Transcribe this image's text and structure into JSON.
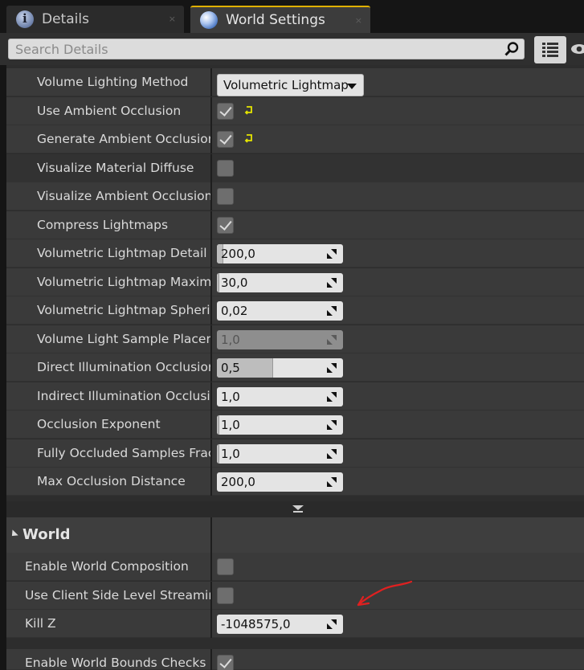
{
  "tabs": [
    {
      "label": "Details",
      "icon": "info-icon",
      "close": "×"
    },
    {
      "label": "World Settings",
      "icon": "globe-icon",
      "close": "×"
    }
  ],
  "search": {
    "placeholder": "Search Details"
  },
  "lighting_rows": [
    {
      "label": "Volume Lighting Method",
      "type": "dropdown",
      "value": "Volumetric Lightmap"
    },
    {
      "label": "Use Ambient Occlusion",
      "type": "checkbox",
      "checked": true,
      "reset": true
    },
    {
      "label": "Generate Ambient Occlusion Material Mask",
      "type": "checkbox",
      "checked": true,
      "reset": true
    },
    {
      "label": "Visualize Material Diffuse",
      "type": "checkbox",
      "checked": false
    },
    {
      "label": "Visualize Ambient Occlusion",
      "type": "checkbox",
      "checked": false
    },
    {
      "label": "Compress Lightmaps",
      "type": "checkbox",
      "checked": true
    },
    {
      "label": "Volumetric Lightmap Detail Cell Size",
      "type": "number",
      "value": "200,0"
    },
    {
      "label": "Volumetric Lightmap Maximum Brick Memory Mb",
      "type": "number",
      "value": "30,0"
    },
    {
      "label": "Volumetric Lightmap Spherical Harmonic Smoothing",
      "type": "number",
      "value": "0,02"
    },
    {
      "label": "Volume Light Sample Placement Scale",
      "type": "number",
      "value": "1,0",
      "disabled": true
    },
    {
      "label": "Direct Illumination Occlusion Fraction",
      "type": "number",
      "value": "0,5"
    },
    {
      "label": "Indirect Illumination Occlusion Fraction",
      "type": "number",
      "value": "1,0"
    },
    {
      "label": "Occlusion Exponent",
      "type": "number",
      "value": "1,0"
    },
    {
      "label": "Fully Occluded Samples Fraction",
      "type": "number",
      "value": "1,0"
    },
    {
      "label": "Max Occlusion Distance",
      "type": "number",
      "value": "200,0"
    }
  ],
  "world_category": {
    "title": "World"
  },
  "world_rows": [
    {
      "label": "Enable World Composition",
      "type": "checkbox",
      "checked": false
    },
    {
      "label": "Use Client Side Level Streaming Volumes",
      "type": "checkbox",
      "checked": false
    },
    {
      "label": "Kill Z",
      "type": "number",
      "value": "-1048575,0"
    }
  ],
  "bottom_row": {
    "label": "Enable World Bounds Checks",
    "checked": true
  },
  "colors": {
    "accent_tab": "#e0b000",
    "reset_arrow": "#e6e600",
    "annotation_arrow": "#e02020"
  }
}
